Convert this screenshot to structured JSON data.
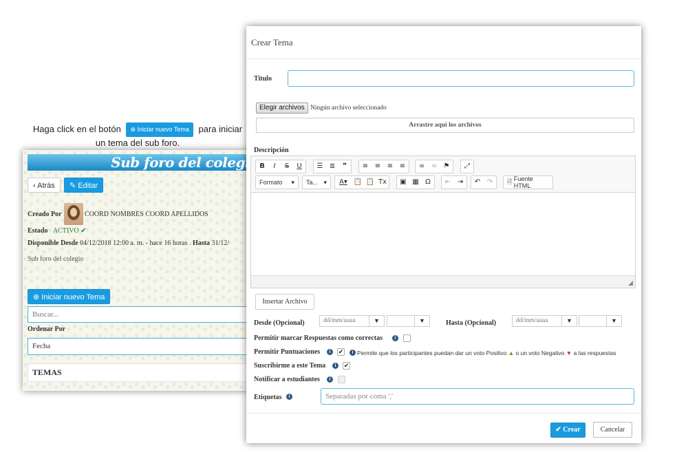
{
  "instructions": {
    "before": "Haga click en el botón",
    "button": "Iniciar nuevo Tema",
    "after": "para iniciar un tema del sub foro."
  },
  "forum": {
    "banner_title": "Sub foro del colegio",
    "back_label": "Atrás",
    "edit_label": "Editar",
    "created_by_label": "Creado Por",
    "created_by_value": "COORD NOMBRES COORD APELLIDOS",
    "status_label": "Estado",
    "status_value": "ACTIVO",
    "available_label": "Disponible Desde",
    "available_value": "04/12/2018 12:00 a. m. - hace 16 horas .",
    "until_label": "Hasta",
    "until_value": "31/12/",
    "description": "Sub foro del colegio",
    "new_topic_label": "Iniciar nuevo Tema",
    "search_placeholder": "Buscar...",
    "order_by_label": "Ordenar Por",
    "order_by_value": "Fecha",
    "topics_header": "TEMAS"
  },
  "modal": {
    "title": "Crear Tema",
    "title_label": "Titulo",
    "title_value": "",
    "choose_file_label": "Elegir archivos",
    "no_file_text": "Ningún archivo seleccionado",
    "drop_text": "Arrastre aquí los archivos",
    "description_label": "Descripción",
    "format_label": "Formato",
    "size_label": "Ta...",
    "source_label": "Fuente HTML",
    "insert_file_label": "Insertar Archivo",
    "from_label": "Desde (Opcional)",
    "to_label": "Hasta (Opcional)",
    "date_placeholder": "dd/mm/aaaa",
    "allow_correct_label": "Permitir marcar Respuestas como correctas",
    "allow_scores_label": "Permitir Puntuaciones",
    "scores_note_a": "Permite que los participantes puedan dar un voto Positivo",
    "scores_note_b": "o un voto Negativo",
    "scores_note_c": "a las respuestas",
    "subscribe_label": "Suscribirme a este Tema",
    "notify_label": "Notificar a estudiantes",
    "tags_label": "Etiquetas",
    "tags_placeholder": "Separadas por coma ','",
    "create_label": "Crear",
    "cancel_label": "Cancelar",
    "allow_correct_checked": false,
    "allow_scores_checked": true,
    "subscribe_checked": true,
    "notify_checked": false
  },
  "colors": {
    "primary": "#1a9be0",
    "focus_border": "#5bb7de",
    "thumb_up": "#5a9a2e",
    "thumb_down": "#c0392b"
  }
}
